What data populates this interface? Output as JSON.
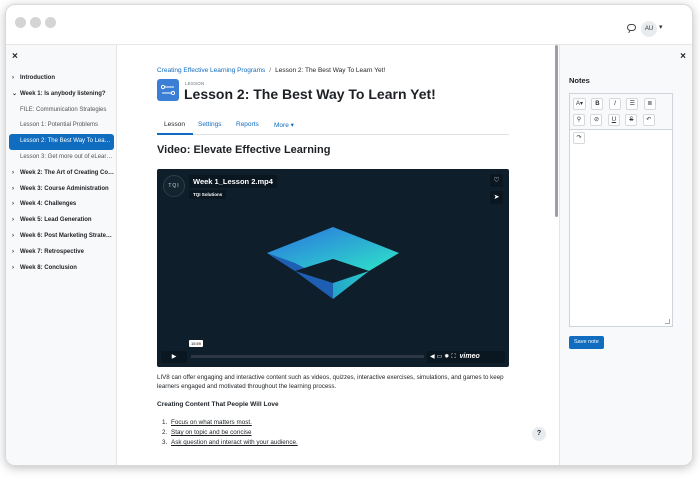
{
  "header": {
    "avatar_initials": "AU"
  },
  "drawer": {
    "close_label": "×",
    "items": [
      {
        "label": "Introduction",
        "type": "section"
      },
      {
        "label": "Week 1: Is anybody listening?",
        "type": "section",
        "expanded": true
      },
      {
        "label": "FILE: Communication Strategies",
        "type": "activity"
      },
      {
        "label": "Lesson 1: Potential Problems",
        "type": "activity"
      },
      {
        "label": "Lesson 2: The Best Way To Learn Yet!",
        "type": "activity",
        "active": true
      },
      {
        "label": "Lesson 3: Get more out of eLearning",
        "type": "activity"
      },
      {
        "label": "Week 2: The Art of Creating Content",
        "type": "section"
      },
      {
        "label": "Week 3: Course Administration",
        "type": "section"
      },
      {
        "label": "Week 4: Challenges",
        "type": "section"
      },
      {
        "label": "Week 5: Lead Generation",
        "type": "section"
      },
      {
        "label": "Week 6: Post Marketing Strategies",
        "type": "section"
      },
      {
        "label": "Week 7: Retrospective",
        "type": "section"
      },
      {
        "label": "Week 8: Conclusion",
        "type": "section"
      }
    ]
  },
  "breadcrumb": {
    "course": "Creating Effective Learning Programs",
    "separator": "/",
    "current": "Lesson 2: The Best Way To Learn Yet!"
  },
  "lesson": {
    "kicker": "LESSON",
    "title": "Lesson 2: The Best Way To Learn Yet!"
  },
  "tabs": [
    {
      "label": "Lesson",
      "active": true
    },
    {
      "label": "Settings"
    },
    {
      "label": "Reports"
    },
    {
      "label": "More ▾"
    }
  ],
  "content": {
    "video_heading": "Video: Elevate Effective Learning",
    "video": {
      "logo": "TQI",
      "title": "Week 1_Lesson 2.mp4",
      "byline": "TQI Solutions",
      "time": "15:59",
      "brand": "vimeo"
    },
    "paragraph": "LIV8 can offer engaging and interactive content such as videos, quizzes, interactive exercises, simulations, and games to keep learners engaged and motivated throughout the learning process.",
    "subheading": "Creating Content That People Will Love",
    "list": [
      "Focus on what matters most.",
      "Stay on topic and be concise",
      "Ask question and interact with your audience."
    ],
    "help_label": "?"
  },
  "notes": {
    "close_label": "×",
    "title": "Notes",
    "save_label": "Save note"
  },
  "colors": {
    "accent": "#0f6cbf",
    "video_bg": "#0e1e2b",
    "art_cyan": "#2ee6c8",
    "art_blue": "#2b6fe0"
  }
}
